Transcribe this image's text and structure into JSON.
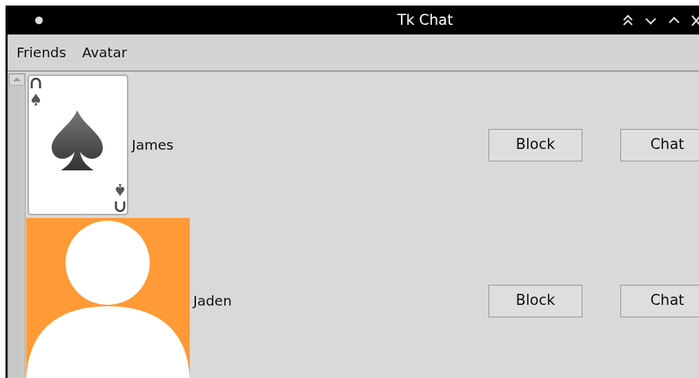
{
  "window": {
    "title": "Tk Chat"
  },
  "menu": [
    {
      "label": "Friends"
    },
    {
      "label": "Avatar"
    }
  ],
  "friends": [
    {
      "name": "James",
      "kind": "card",
      "actions": [
        "Block",
        "Chat"
      ]
    },
    {
      "name": "Jaden",
      "kind": "silhouette",
      "actions": [
        "Block",
        "Chat"
      ]
    }
  ]
}
